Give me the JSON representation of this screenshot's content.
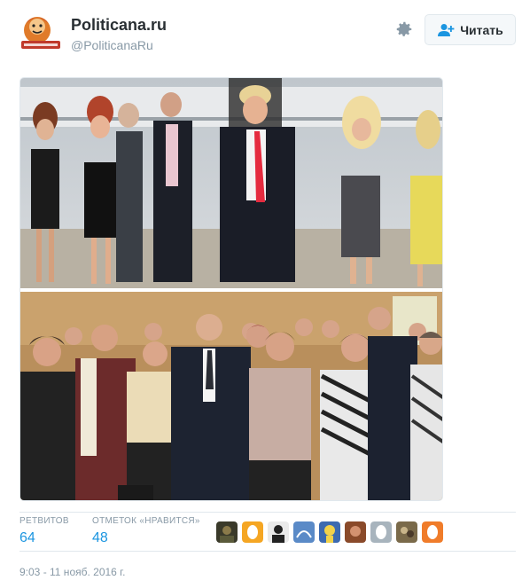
{
  "tweet": {
    "author": {
      "name": "Politicana.ru",
      "handle": "@PoliticanaRu",
      "avatar_icon": "politicana-logo-icon"
    },
    "follow_button_label": "Читать",
    "settings_icon": "gear-icon",
    "media": [
      {
        "description_icon": "photo",
        "alt": ""
      },
      {
        "description_icon": "photo",
        "alt": ""
      }
    ],
    "stats": {
      "retweets_label": "РЕТВИТОВ",
      "retweets_value": "64",
      "likes_label": "ОТМЕТОК «НРАВИТСЯ»",
      "likes_value": "48"
    },
    "likers_count_shown": 9,
    "timestamp": "9:03 - 11 нояб. 2016 г."
  },
  "colors": {
    "link_blue": "#1b95e0",
    "muted_gray": "#8899a6",
    "border": "#e1e8ed"
  }
}
